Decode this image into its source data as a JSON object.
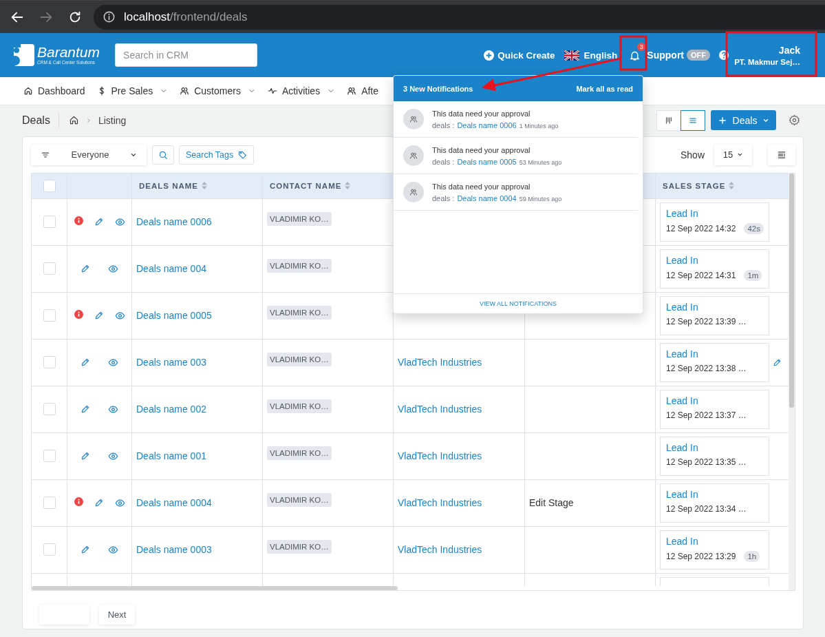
{
  "browser": {
    "url_host": "localhost",
    "url_path": "/frontend/deals"
  },
  "header": {
    "logo_name": "Barantum",
    "logo_tagline": "CRM & Call Center Solutions",
    "search": {
      "placeholder": "Search in CRM"
    },
    "quick_create": "Quick Create",
    "language": "English",
    "notification_count": "3",
    "support": {
      "label": "Support",
      "on": false,
      "toggle_text": "OFF"
    },
    "user": {
      "name": "Jack",
      "company": "PT. Makmur Sej…"
    }
  },
  "nav": [
    {
      "label": "Dashboard",
      "dropdown": false
    },
    {
      "label": "Pre Sales",
      "dropdown": true
    },
    {
      "label": "Customers",
      "dropdown": true
    },
    {
      "label": "Activities",
      "dropdown": true
    },
    {
      "label": "Afte",
      "dropdown": false
    }
  ],
  "breadcrumb": {
    "title": "Deals",
    "current": "Listing"
  },
  "views": [
    {
      "kind": "kanban",
      "selected": false
    },
    {
      "kind": "list",
      "selected": true
    }
  ],
  "add_button": "Deals",
  "filter": {
    "owner": "Everyone",
    "tags_button": "Search Tags",
    "show_label": "Show",
    "page_size": "15"
  },
  "table": {
    "header_checked": false,
    "columns": [
      "DEALS NAME",
      "CONTACT NAME",
      "SALES STAGE"
    ],
    "rows": [
      {
        "checked": false,
        "alert": true,
        "name": "Deals name 0006",
        "contact": "VLADIMIR KO…",
        "stage": "Lead In",
        "stage_time": "12 Sep 2022 14:32",
        "age": "42s"
      },
      {
        "checked": false,
        "alert": false,
        "name": "Deals name 004",
        "contact": "VLADIMIR KO…",
        "stage": "Lead In",
        "stage_time": "12 Sep 2022 14:31",
        "age": "1m"
      },
      {
        "checked": false,
        "alert": true,
        "name": "Deals name 0005",
        "contact": "VLADIMIR KO…",
        "stage": "Lead In",
        "stage_time": "12 Sep 2022 13:39 …"
      },
      {
        "checked": false,
        "alert": false,
        "name": "Deals name 003",
        "contact": "VLADIMIR KO…",
        "company": "VladTech Industries",
        "stage": "Lead In",
        "stage_time": "12 Sep 2022 13:38 …",
        "row_edit": true
      },
      {
        "checked": false,
        "alert": false,
        "name": "Deals name 002",
        "contact": "VLADIMIR KO…",
        "company": "VladTech Industries",
        "stage": "Lead In",
        "stage_time": "12 Sep 2022 13:37 …"
      },
      {
        "checked": false,
        "alert": false,
        "name": "Deals name 001",
        "contact": "VLADIMIR KO…",
        "company": "VladTech Industries",
        "stage": "Lead In",
        "stage_time": "12 Sep 2022 13:35 …"
      },
      {
        "checked": false,
        "alert": true,
        "name": "Deals name 0004",
        "contact": "VLADIMIR KO…",
        "company": "VladTech Industries",
        "note": "Edit Stage",
        "stage": "Lead In",
        "stage_time": "12 Sep 2022 13:34 …"
      },
      {
        "checked": false,
        "alert": false,
        "name": "Deals name 0003",
        "contact": "VLADIMIR KO…",
        "company": "VladTech Industries",
        "stage": "Lead In",
        "stage_time": "12 Sep 2022 13:29",
        "age": "1h"
      }
    ]
  },
  "pagination": {
    "next": "Next"
  },
  "notifications": {
    "title": "3 New Notifications",
    "mark_all": "Mark all as read",
    "footer": "VIEW ALL NOTIFICATIONS",
    "items": [
      {
        "message": "This data need your approval",
        "module": "deals :",
        "link": "Deals name 0006",
        "time": "1 Minutes ago"
      },
      {
        "message": "This data need your approval",
        "module": "deals :",
        "link": "Deals name 0005",
        "time": "53 Minutes ago"
      },
      {
        "message": "This data need your approval",
        "module": "deals :",
        "link": "Deals name 0004",
        "time": "59 Minutes ago"
      }
    ]
  }
}
